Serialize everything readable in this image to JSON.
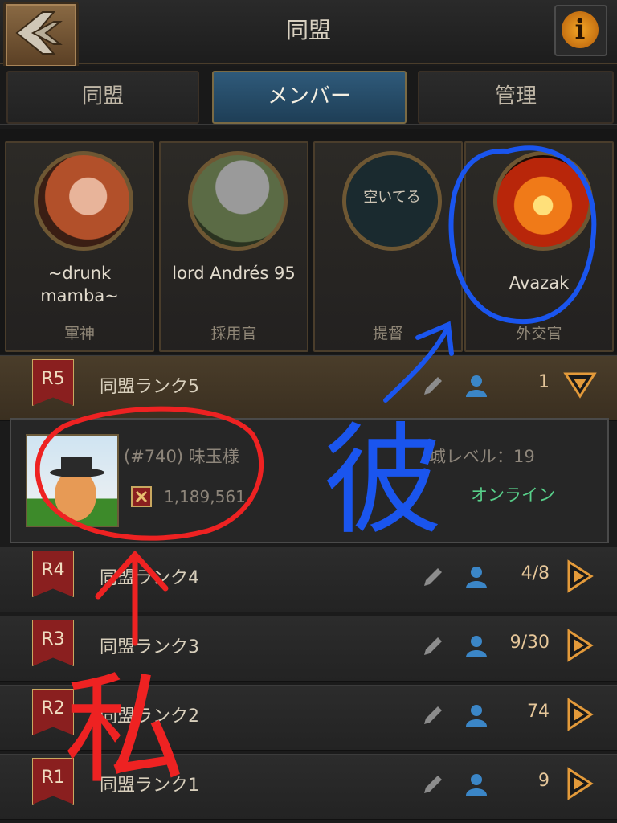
{
  "header": {
    "title": "同盟",
    "back_icon": "back-arrow-icon",
    "info_icon": "info-icon",
    "info_glyph": "i"
  },
  "tabs": [
    {
      "label": "同盟",
      "active": false
    },
    {
      "label": "メンバー",
      "active": true
    },
    {
      "label": "管理",
      "active": false
    }
  ],
  "officers": [
    {
      "name": "~drunk mamba~",
      "role": "軍神"
    },
    {
      "name": "lord Andrés 95",
      "role": "採用官"
    },
    {
      "name": "",
      "empty_label": "空いてる",
      "role": "提督"
    },
    {
      "name": "Avazak",
      "role": "外交官"
    }
  ],
  "ranks": [
    {
      "badge": "R5",
      "label": "同盟ランク5",
      "count": "1",
      "expanded": true
    },
    {
      "badge": "R4",
      "label": "同盟ランク4",
      "count": "4/8",
      "expanded": false
    },
    {
      "badge": "R3",
      "label": "同盟ランク3",
      "count": "9/30",
      "expanded": false
    },
    {
      "badge": "R2",
      "label": "同盟ランク2",
      "count": "74",
      "expanded": false
    },
    {
      "badge": "R1",
      "label": "同盟ランク1",
      "count": "9",
      "expanded": false
    }
  ],
  "member": {
    "name": "(#740) 味玉様",
    "power": "1,189,561",
    "level": "城レベル：19",
    "status": "オンライン"
  },
  "annotations": {
    "blue_text": "彼",
    "red_text": "私"
  },
  "colors": {
    "accent_blue": "#2f5a7a",
    "online_green": "#58d08a",
    "rank_red": "#8a1f1f",
    "annotation_red": "#ee2222",
    "annotation_blue": "#1a55ee"
  }
}
